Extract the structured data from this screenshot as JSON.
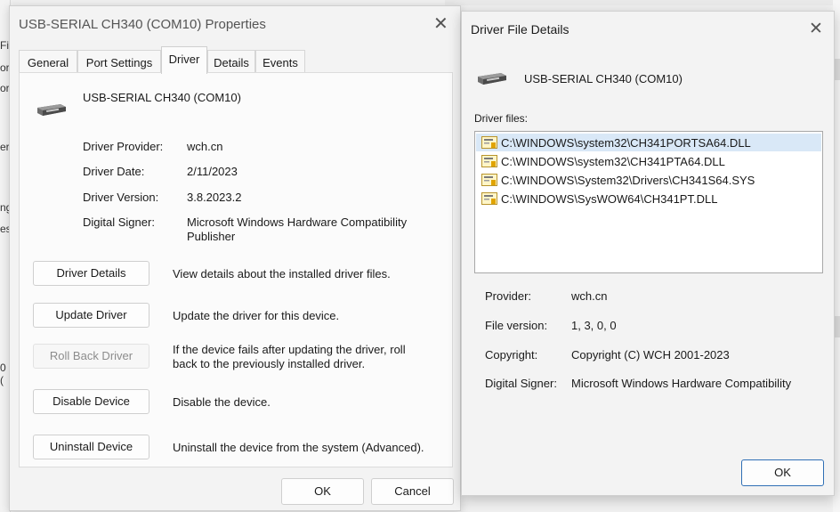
{
  "background": {
    "left_fragments": [
      "Fi",
      "or",
      "or",
      "er",
      "ng",
      "es",
      "0 ("
    ]
  },
  "properties_window": {
    "title": "USB-SERIAL CH340 (COM10) Properties",
    "tabs": [
      "General",
      "Port Settings",
      "Driver",
      "Details",
      "Events"
    ],
    "active_tab": "Driver",
    "device_name": "USB-SERIAL CH340 (COM10)",
    "fields": [
      {
        "label": "Driver Provider:",
        "value": "wch.cn"
      },
      {
        "label": "Driver Date:",
        "value": "2/11/2023"
      },
      {
        "label": "Driver Version:",
        "value": "3.8.2023.2"
      },
      {
        "label": "Digital Signer:",
        "value": "Microsoft Windows Hardware Compatibility Publisher"
      }
    ],
    "actions": [
      {
        "button": "Driver Details",
        "description": "View details about the installed driver files.",
        "enabled": true
      },
      {
        "button": "Update Driver",
        "description": "Update the driver for this device.",
        "enabled": true
      },
      {
        "button": "Roll Back Driver",
        "description": "If the device fails after updating the driver, roll back to the previously installed driver.",
        "enabled": false
      },
      {
        "button": "Disable Device",
        "description": "Disable the device.",
        "enabled": true
      },
      {
        "button": "Uninstall Device",
        "description": "Uninstall the device from the system (Advanced).",
        "enabled": true
      }
    ],
    "ok_label": "OK",
    "cancel_label": "Cancel"
  },
  "driver_file_details": {
    "title": "Driver File Details",
    "device_name": "USB-SERIAL CH340 (COM10)",
    "files_label": "Driver files:",
    "files": [
      "C:\\WINDOWS\\system32\\CH341PORTSA64.DLL",
      "C:\\WINDOWS\\system32\\CH341PTA64.DLL",
      "C:\\WINDOWS\\System32\\Drivers\\CH341S64.SYS",
      "C:\\WINDOWS\\SysWOW64\\CH341PT.DLL"
    ],
    "selected_file_index": 0,
    "details": [
      {
        "label": "Provider:",
        "value": "wch.cn"
      },
      {
        "label": "File version:",
        "value": "1, 3, 0, 0"
      },
      {
        "label": "Copyright:",
        "value": "Copyright (C) WCH 2001-2023"
      },
      {
        "label": "Digital Signer:",
        "value": "Microsoft Windows Hardware Compatibility"
      }
    ],
    "ok_label": "OK"
  },
  "icons": {
    "device": "usb-serial-device-icon",
    "file": "driver-file-icon",
    "close": "close-icon"
  }
}
